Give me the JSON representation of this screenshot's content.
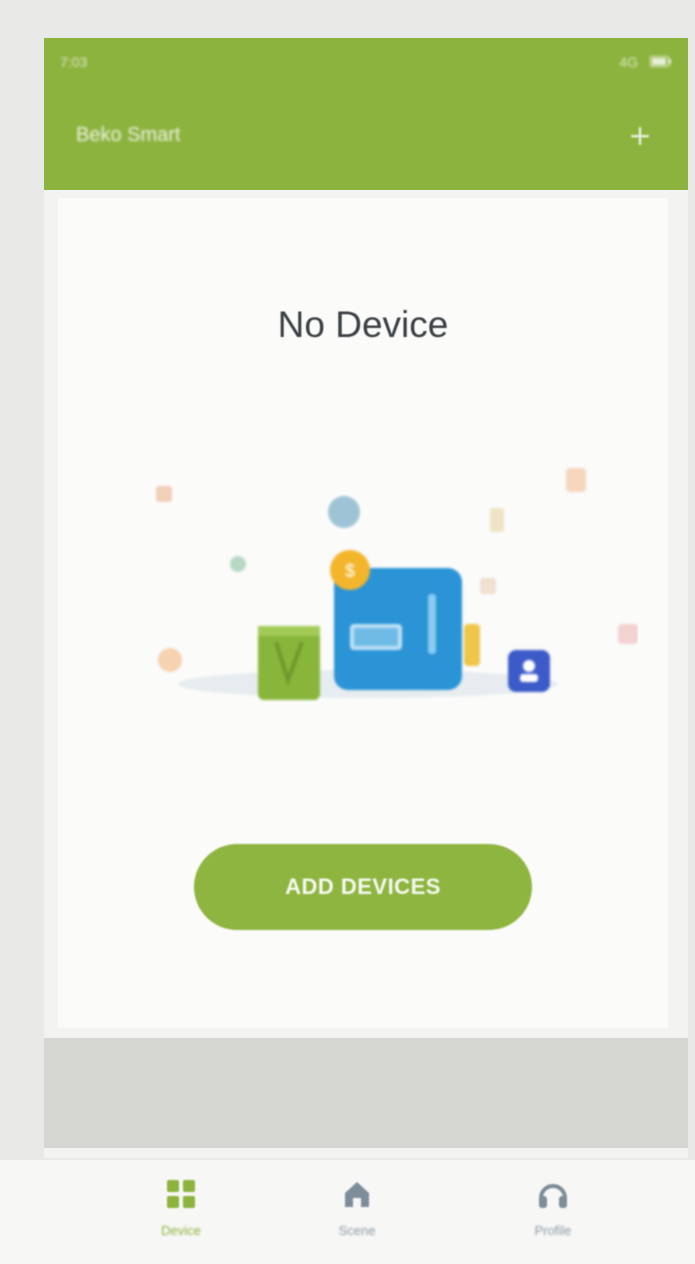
{
  "status_bar": {
    "left_text": "7:03",
    "right_text": "4G"
  },
  "header": {
    "title": "Beko Smart",
    "add_icon": "plus-icon"
  },
  "empty_state": {
    "title": "No Device",
    "button_label": "ADD DEVICES"
  },
  "tabs": [
    {
      "label": "Device",
      "icon": "grid-icon",
      "active": true
    },
    {
      "label": "Scene",
      "icon": "home-icon",
      "active": false
    },
    {
      "label": "Profile",
      "icon": "headset-icon",
      "active": false
    }
  ],
  "colors": {
    "accent": "#8db33f",
    "inactive_tab": "#8a9aa6",
    "device_blue": "#2a94d6",
    "device_green": "#88b63a"
  }
}
